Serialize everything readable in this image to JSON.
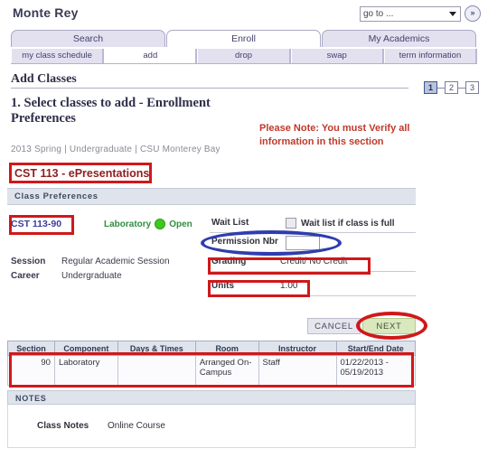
{
  "header": {
    "app_title": "Monte Rey",
    "goto_value": "go to ...",
    "goto_button_icon": "»"
  },
  "tabs": [
    {
      "label": "Search",
      "active": false
    },
    {
      "label": "Enroll",
      "active": true
    },
    {
      "label": "My Academics",
      "active": false
    }
  ],
  "subtabs": [
    {
      "label": "my class schedule",
      "active": false
    },
    {
      "label": "add",
      "active": true
    },
    {
      "label": "drop",
      "active": false
    },
    {
      "label": "swap",
      "active": false
    },
    {
      "label": "term information",
      "active": false
    }
  ],
  "page": {
    "title": "Add Classes",
    "section_heading": "1.  Select classes to add - Enrollment Preferences",
    "breadcrumb": "2013 Spring | Undergraduate | CSU Monterey Bay",
    "annotation_note": "Please Note: You must Verify all information in this section"
  },
  "steps": [
    {
      "label": "1",
      "current": true
    },
    {
      "label": "2",
      "current": false
    },
    {
      "label": "3",
      "current": false
    }
  ],
  "course": {
    "title": "CST  113 - ePresentations",
    "class_preferences_header": "Class Preferences",
    "class_link": "CST  113-90",
    "component": "Laboratory",
    "status": "Open",
    "session_label": "Session",
    "session_value": "Regular Academic Session",
    "career_label": "Career",
    "career_value": "Undergraduate"
  },
  "preferences": {
    "waitlist_label": "Wait List",
    "waitlist_checkbox_text": "Wait list if class is full",
    "waitlist_checked": false,
    "permission_label": "Permission Nbr",
    "permission_value": "",
    "grading_label": "Grading",
    "grading_value": "Credit/ No Credit",
    "units_label": "Units",
    "units_value": "1.00"
  },
  "buttons": {
    "cancel": "CANCEL",
    "next": "NEXT"
  },
  "class_table": {
    "columns": [
      "Section",
      "Component",
      "Days & Times",
      "Room",
      "Instructor",
      "Start/End Date"
    ],
    "rows": [
      {
        "section": "90",
        "component": "Laboratory",
        "days_times": "",
        "room": "Arranged On-Campus",
        "instructor": "Staff",
        "start_end_date": "01/22/2013 - 05/19/2013"
      }
    ]
  },
  "notes": {
    "header": "NOTES",
    "label": "Class Notes",
    "value": "Online Course"
  },
  "colors": {
    "annotation_red": "#d0181a",
    "annotation_blue": "#2e3dae",
    "status_green": "#3ec91e",
    "tab_lavender": "#e3e0f0",
    "section_bar": "#dfe3ec",
    "next_button_green": "#d9e9bd"
  }
}
